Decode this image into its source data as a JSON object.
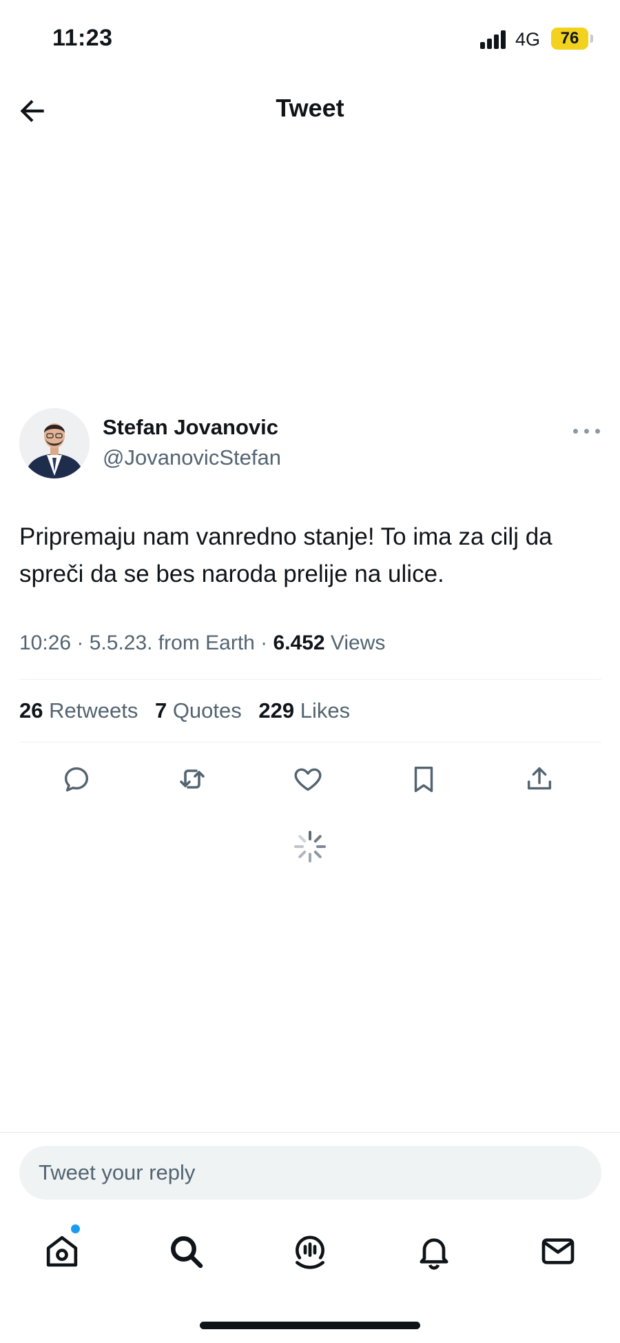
{
  "status_bar": {
    "time": "11:23",
    "network": "4G",
    "battery": "76"
  },
  "nav": {
    "title": "Tweet",
    "back_icon": "back-arrow-icon"
  },
  "tweet": {
    "author_name": "Stefan Jovanovic",
    "author_handle": "@JovanovicStefan",
    "text": "Pripremaju nam vanredno stanje! To ima za cilj da spreči da se bes naroda prelije na ulice.",
    "meta_prefix": "10:26 · 5.5.23. from Earth · ",
    "views_count": "6.452",
    "views_label": " Views",
    "retweets_count": "26",
    "retweets_label": " Retweets",
    "quotes_count": "7",
    "quotes_label": " Quotes",
    "likes_count": "229",
    "likes_label": " Likes"
  },
  "reply": {
    "placeholder": "Tweet your reply"
  },
  "colors": {
    "text_primary": "#0f1419",
    "text_secondary": "#536471",
    "accent": "#1d9bf0",
    "battery": "#f2d21c",
    "reply_bg": "#eff3f4"
  },
  "icons": {
    "actions": [
      "reply-icon",
      "retweet-icon",
      "like-icon",
      "bookmark-icon",
      "share-icon"
    ],
    "tabs": [
      "home-icon",
      "search-icon",
      "spaces-icon",
      "notifications-icon",
      "messages-icon"
    ]
  }
}
